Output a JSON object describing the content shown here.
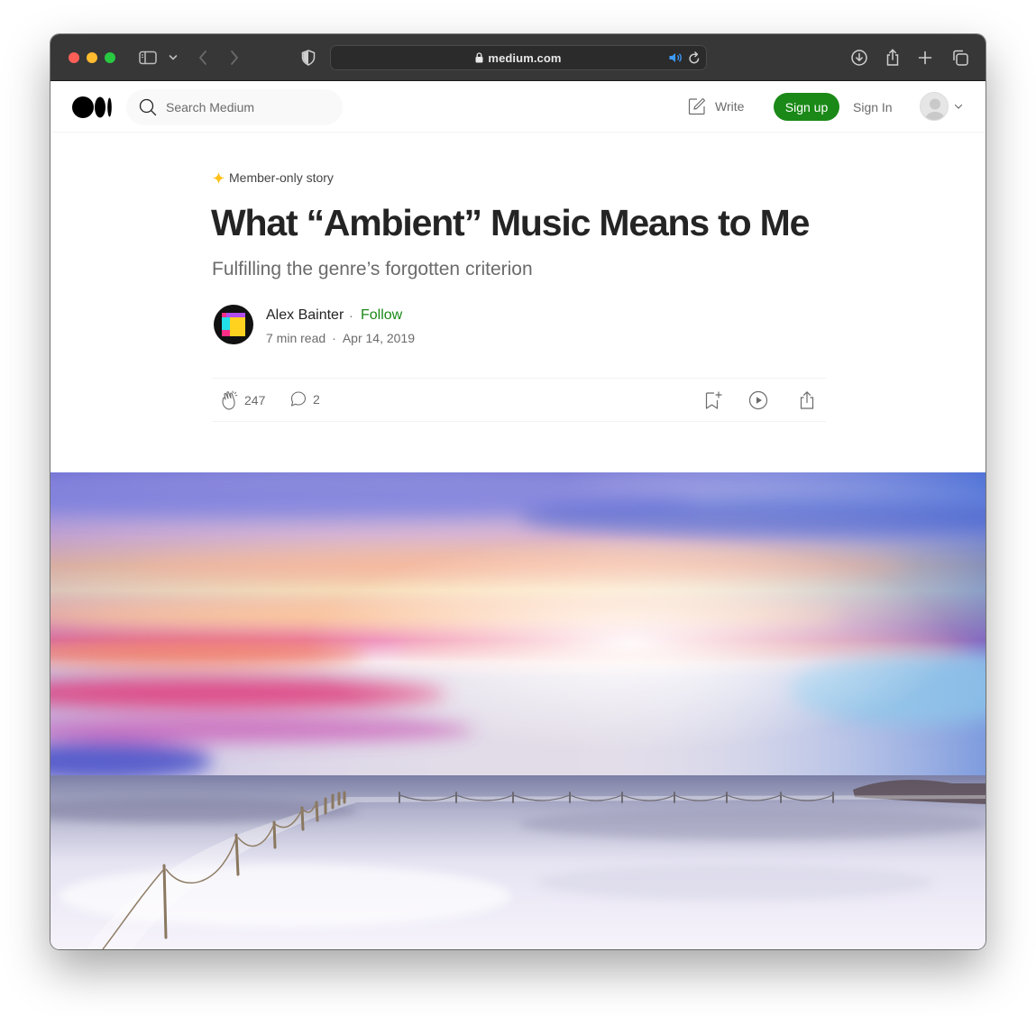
{
  "browser": {
    "url_host": "medium.com"
  },
  "header": {
    "search_placeholder": "Search Medium",
    "write_label": "Write",
    "signup_label": "Sign up",
    "signin_label": "Sign In"
  },
  "article": {
    "member_badge": "Member-only story",
    "title": "What “Ambient” Music Means to Me",
    "subtitle": "Fulfilling the genre’s forgotten criterion",
    "author": "Alex Bainter",
    "follow_label": "Follow",
    "separator": "·",
    "read_time": "7 min read",
    "date": "Apr 14, 2019",
    "claps": "247",
    "responses": "2"
  },
  "colors": {
    "accent_green": "#1a8917",
    "member_star": "#ffc017",
    "text_primary": "#242424",
    "text_secondary": "#6b6b6b"
  },
  "icons": [
    "search-icon",
    "write-icon",
    "clap-icon",
    "comment-icon",
    "bookmark-icon",
    "play-icon",
    "share-icon",
    "lock-icon",
    "speaker-icon",
    "reload-icon",
    "sidebar-icon",
    "download-icon",
    "new-tab-icon",
    "tabs-icon",
    "shield-icon"
  ]
}
